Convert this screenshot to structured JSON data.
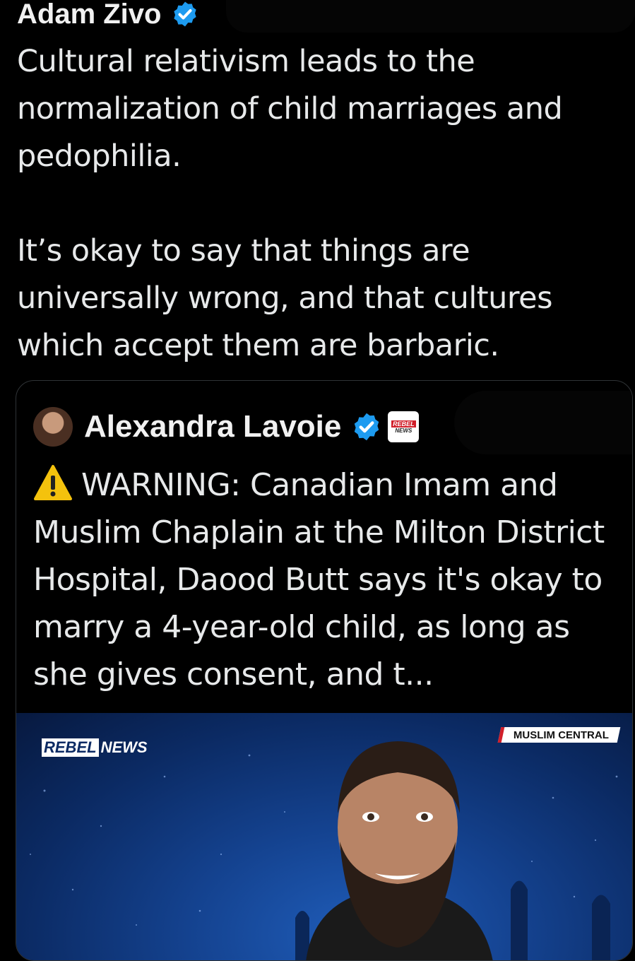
{
  "tweet": {
    "author_name": "Adam Zivo",
    "verified_icon": "verified-badge-icon",
    "paragraphs": [
      "Cultural relativism leads to the normalization of child marriages and pedophilia.",
      "It’s okay to say that things are universally wrong, and that cultures which accept them are barbaric."
    ]
  },
  "quoted_tweet": {
    "author_name": "Alexandra Lavoie",
    "verified_icon": "verified-badge-icon",
    "affiliation_icon": "rebel-news-badge",
    "text": "WARNING: Canadian Imam and Muslim Chaplain at the Milton District Hospital, Daood Butt says it's okay to marry a 4-year-old child, as long as she gives consent, and t...",
    "warning_icon": "warning-icon",
    "media": {
      "logo_rebel": "REBEL",
      "logo_news": "NEWS",
      "tag": "MUSLIM CENTRAL"
    }
  },
  "colors": {
    "background": "#000000",
    "text": "#e7e9ea",
    "verified_blue": "#1d9bf0",
    "rebel_red": "#d11f2a",
    "card_border": "#2f3336"
  }
}
